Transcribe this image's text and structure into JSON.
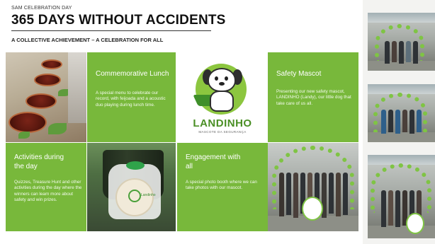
{
  "header": {
    "eyebrow": "SAM CELEBRATION DAY",
    "title": "365 DAYS WITHOUT ACCIDENTS",
    "subtitle": "A COLLECTIVE ACHIEVEMENT – A CELEBRATION FOR ALL"
  },
  "tiles": {
    "lunch": {
      "title": "Commemorative Lunch",
      "text": "A special menu to celebrate our record, with feijoada and a acoustic duo playing during lunch time."
    },
    "mascot": {
      "title": "Safety Mascot",
      "text": "Presenting our new safety mascot, LANDINHO (Landy), our little dog that take care of us all."
    },
    "activities": {
      "title": "Activities during the day",
      "text": "Quizzes, Treasure Hunt and other activities during the day where the winners can learn more about safety and win prizes."
    },
    "engagement": {
      "title": "Engagement with all",
      "text": "A special photo booth where we can take photos with our mascot."
    }
  },
  "logo": {
    "name": "LANDINHO",
    "tagline": "MASCOTE DA SEGURANÇA",
    "cookie_text": "Landinho"
  },
  "colors": {
    "accent_green": "#78b83b",
    "brand_green": "#4a8f25"
  }
}
